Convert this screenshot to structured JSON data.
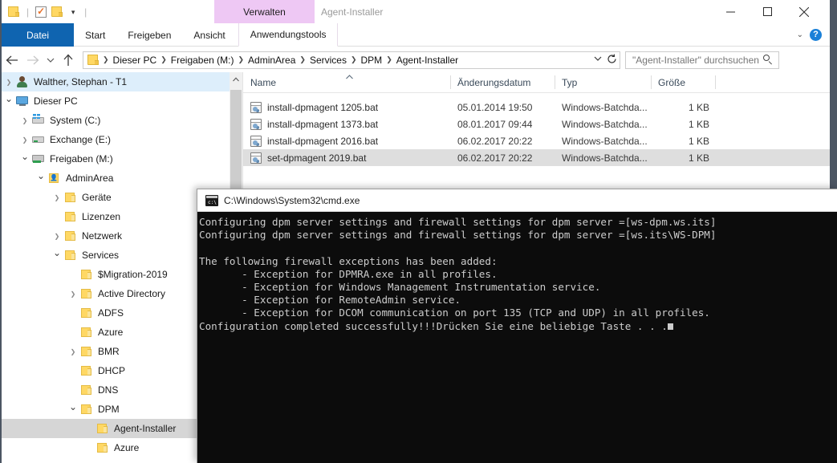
{
  "window": {
    "title": "Agent-Installer",
    "contextual_tab_group": "Verwalten",
    "minimize_label": "Minimieren",
    "maximize_label": "Maximieren",
    "close_label": "Schließen"
  },
  "quick_access": {
    "items": [
      {
        "name": "folder-icon",
        "label": ""
      },
      {
        "name": "properties-icon",
        "label": ""
      },
      {
        "name": "new-folder-icon",
        "label": ""
      }
    ]
  },
  "ribbon": {
    "tabs": [
      {
        "label": "Datei",
        "active": true,
        "kind": "file"
      },
      {
        "label": "Start",
        "active": false,
        "kind": "normal"
      },
      {
        "label": "Freigeben",
        "active": false,
        "kind": "normal"
      },
      {
        "label": "Ansicht",
        "active": false,
        "kind": "normal"
      },
      {
        "label": "Anwendungstools",
        "active": true,
        "kind": "contextual"
      }
    ],
    "collapse_label": "⌄",
    "help_label": "?"
  },
  "navigation": {
    "back_label": "←",
    "forward_label": "→",
    "recent_label": "⌄",
    "up_label": "↑",
    "refresh_label": "↻",
    "dropdown_label": "⌄"
  },
  "breadcrumb": {
    "items": [
      "Dieser PC",
      "Freigaben (M:)",
      "AdminArea",
      "Services",
      "DPM",
      "Agent-Installer"
    ],
    "separator": "❯"
  },
  "search": {
    "placeholder": "\"Agent-Installer\" durchsuchen"
  },
  "tree": {
    "items": [
      {
        "label": "Walther, Stephan - T1",
        "depth": 1,
        "twisty": "closed",
        "icon": "user",
        "state": "sel-light"
      },
      {
        "label": "Dieser PC",
        "depth": 1,
        "twisty": "open",
        "icon": "pc",
        "state": ""
      },
      {
        "label": "System (C:)",
        "depth": 2,
        "twisty": "closed",
        "icon": "drive-sys",
        "state": ""
      },
      {
        "label": "Exchange (E:)",
        "depth": 2,
        "twisty": "closed",
        "icon": "drive",
        "state": ""
      },
      {
        "label": "Freigaben (M:)",
        "depth": 2,
        "twisty": "open",
        "icon": "drive-net",
        "state": ""
      },
      {
        "label": "AdminArea",
        "depth": 3,
        "twisty": "open",
        "icon": "folder-share",
        "state": ""
      },
      {
        "label": "Geräte",
        "depth": 4,
        "twisty": "closed",
        "icon": "folder",
        "state": ""
      },
      {
        "label": "Lizenzen",
        "depth": 4,
        "twisty": "none",
        "icon": "folder",
        "state": ""
      },
      {
        "label": "Netzwerk",
        "depth": 4,
        "twisty": "closed",
        "icon": "folder",
        "state": ""
      },
      {
        "label": "Services",
        "depth": 4,
        "twisty": "open",
        "icon": "folder",
        "state": ""
      },
      {
        "label": "$Migration-2019",
        "depth": 5,
        "twisty": "none",
        "icon": "folder",
        "state": ""
      },
      {
        "label": "Active Directory",
        "depth": 5,
        "twisty": "closed",
        "icon": "folder",
        "state": ""
      },
      {
        "label": "ADFS",
        "depth": 5,
        "twisty": "none",
        "icon": "folder",
        "state": ""
      },
      {
        "label": "Azure",
        "depth": 5,
        "twisty": "none",
        "icon": "folder",
        "state": ""
      },
      {
        "label": "BMR",
        "depth": 5,
        "twisty": "closed",
        "icon": "folder",
        "state": ""
      },
      {
        "label": "DHCP",
        "depth": 5,
        "twisty": "none",
        "icon": "folder",
        "state": ""
      },
      {
        "label": "DNS",
        "depth": 5,
        "twisty": "none",
        "icon": "folder",
        "state": ""
      },
      {
        "label": "DPM",
        "depth": 5,
        "twisty": "open",
        "icon": "folder",
        "state": ""
      },
      {
        "label": "Agent-Installer",
        "depth": 6,
        "twisty": "none",
        "icon": "folder",
        "state": "sel-gray"
      },
      {
        "label": "Azure",
        "depth": 6,
        "twisty": "none",
        "icon": "folder",
        "state": ""
      }
    ]
  },
  "filelist": {
    "columns": [
      {
        "label": "Name",
        "key": "name"
      },
      {
        "label": "Änderungsdatum",
        "key": "date"
      },
      {
        "label": "Typ",
        "key": "type"
      },
      {
        "label": "Größe",
        "key": "size"
      }
    ],
    "sort_indicator": "⌃",
    "rows": [
      {
        "name": "install-dpmagent 1205.bat",
        "date": "05.01.2014 19:50",
        "type": "Windows-Batchda...",
        "size": "1 KB",
        "selected": false
      },
      {
        "name": "install-dpmagent 1373.bat",
        "date": "08.01.2017 09:44",
        "type": "Windows-Batchda...",
        "size": "1 KB",
        "selected": false
      },
      {
        "name": "install-dpmagent 2016.bat",
        "date": "06.02.2017 20:22",
        "type": "Windows-Batchda...",
        "size": "1 KB",
        "selected": false
      },
      {
        "name": "set-dpmagent 2019.bat",
        "date": "06.02.2017 20:22",
        "type": "Windows-Batchda...",
        "size": "1 KB",
        "selected": true
      }
    ]
  },
  "console": {
    "title": "C:\\Windows\\System32\\cmd.exe",
    "icon_glyph": "C:\\",
    "lines": [
      "Configuring dpm server settings and firewall settings for dpm server =[ws-dpm.ws.its]",
      "Configuring dpm server settings and firewall settings for dpm server =[ws.its\\WS-DPM]",
      "",
      "The following firewall exceptions has been added:",
      "       - Exception for DPMRA.exe in all profiles.",
      "       - Exception for Windows Management Instrumentation service.",
      "       - Exception for RemoteAdmin service.",
      "       - Exception for DCOM communication on port 135 (TCP and UDP) in all profiles.",
      "Configuration completed successfully!!!Drücken Sie eine beliebige Taste . . ."
    ]
  },
  "colors": {
    "file_tab_blue": "#0f64b0",
    "contextual_purple": "#eec8f4",
    "selection_light": "#ddeefb",
    "selection_gray": "#d6d6d6",
    "console_bg": "#0c0c0c",
    "console_fg": "#cccccc",
    "window_border": "#4c5663"
  }
}
